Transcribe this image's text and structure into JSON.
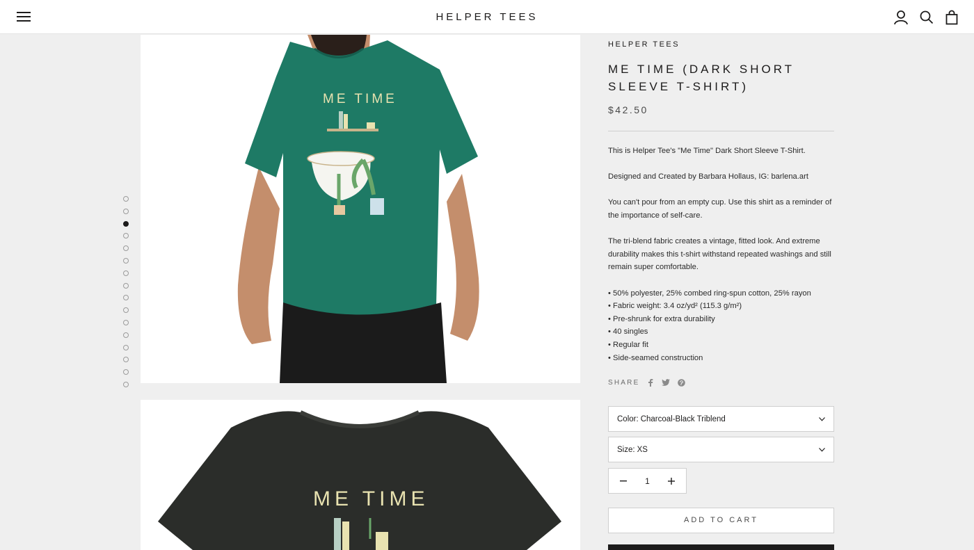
{
  "header": {
    "brand": "HELPER TEES"
  },
  "gallery": {
    "dot_count": 16,
    "active_index": 2,
    "image1_shirt_color": "#1e7a65",
    "image2_shirt_color": "#2b2d2a",
    "shirt_graphic_text": "ME TIME"
  },
  "product": {
    "vendor": "HELPER TEES",
    "title": "ME TIME (DARK SHORT SLEEVE T-SHIRT)",
    "price": "$42.50",
    "description": [
      "This is Helper Tee's \"Me Time\" Dark Short Sleeve T-Shirt.",
      "Designed and Created by Barbara Hollaus, IG: barlena.art",
      "You can't pour from an empty cup. Use this shirt as a reminder of the importance of self-care.",
      "The tri-blend fabric creates a vintage, fitted look. And extreme durability makes this t-shirt withstand repeated washings and still remain super comfortable."
    ],
    "bullets": [
      "• 50% polyester, 25% combed ring-spun cotton, 25% rayon",
      "• Fabric weight: 3.4 oz/yd² (115.3 g/m²)",
      "• Pre-shrunk for extra durability",
      "• 40 singles",
      "• Regular fit",
      "• Side-seamed construction"
    ],
    "share_label": "SHARE",
    "color_label": "Color:",
    "color_value": "Charcoal-Black Triblend",
    "size_label": "Size:",
    "size_value": "XS",
    "quantity": "1",
    "add_to_cart": "ADD TO CART"
  }
}
